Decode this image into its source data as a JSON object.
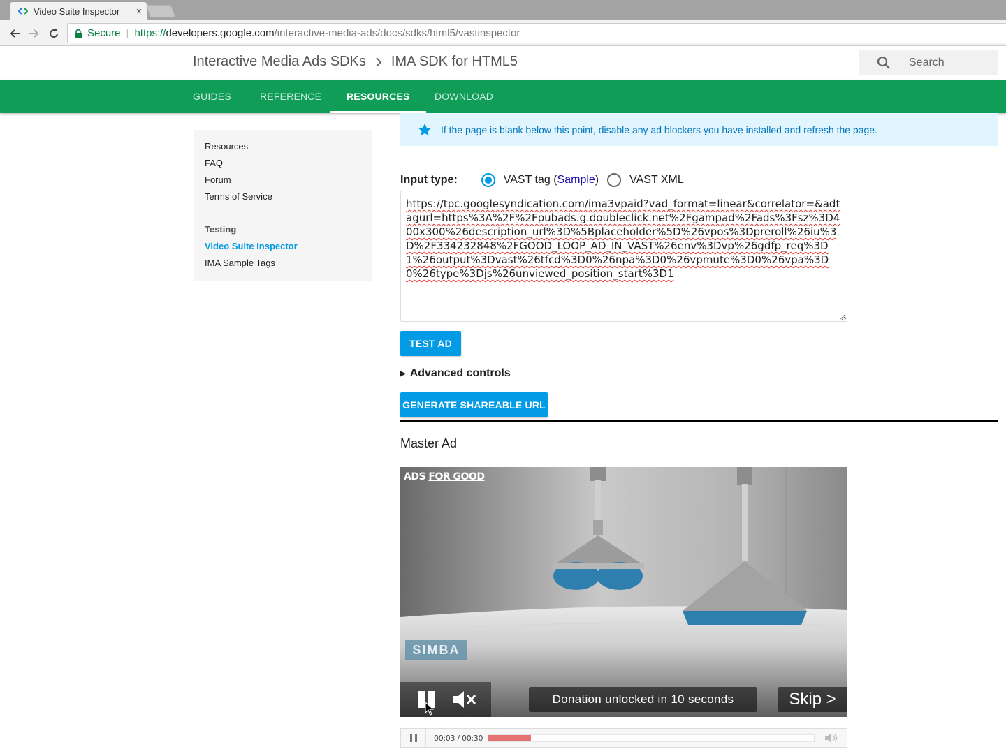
{
  "browser": {
    "tab_title": "Video Suite Inspector",
    "tab_close": "×",
    "secure_label": "Secure",
    "url_scheme": "https://",
    "url_host": "developers.google.com",
    "url_path": "/interactive-media-ads/docs/sdks/html5/vastinspector"
  },
  "header": {
    "breadcrumb_1": "Interactive Media Ads SDKs",
    "breadcrumb_2": "IMA SDK for HTML5",
    "search_placeholder": "Search"
  },
  "nav_tabs": [
    {
      "label": "GUIDES",
      "active": false
    },
    {
      "label": "REFERENCE",
      "active": false
    },
    {
      "label": "RESOURCES",
      "active": true
    },
    {
      "label": "DOWNLOAD",
      "active": false
    }
  ],
  "sidebar": {
    "items": [
      "Resources",
      "FAQ",
      "Forum",
      "Terms of Service"
    ],
    "section_heading": "Testing",
    "section_items": [
      {
        "label": "Video Suite Inspector",
        "active": true
      },
      {
        "label": "IMA Sample Tags",
        "active": false
      }
    ]
  },
  "notice": {
    "text": "If the page is blank below this point, disable any ad blockers you have installed and refresh the page.",
    "color": "#0277bd"
  },
  "form": {
    "input_type_label": "Input type:",
    "option_vast_tag_prefix": "VAST tag (",
    "option_vast_tag_link": "Sample",
    "option_vast_tag_suffix": ")",
    "option_vast_xml": "VAST XML",
    "selected_option": "VAST tag",
    "vast_tag_value": "https://tpc.googlesyndication.com/ima3vpaid?vad_format=linear&correlator=&adtagurl=https%3A%2F%2Fpubads.g.doubleclick.net%2Fgampad%2Fads%3Fsz%3D400x300%26description_url%3D%5Bplaceholder%5D%26vpos%3Dpreroll%26iu%3D%2F334232848%2FGOOD_LOOP_AD_IN_VAST%26env%3Dvp%26gdfp_req%3D1%26output%3Dvast%26tfcd%3D0%26npa%3D0%26vpmute%3D0%26vpa%3D0%26type%3Djs%26unviewed_position_start%3D1",
    "test_ad_button": "TEST AD",
    "advanced_controls": "Advanced controls",
    "generate_url_button": "GENERATE SHAREABLE URL",
    "accent_color": "#039be5"
  },
  "master_ad": {
    "heading": "Master Ad",
    "brand_left": "ADS ",
    "brand_right": "FOR GOOD",
    "product_logo": "SIMBA",
    "donation_text": "Donation unlocked in 10 seconds",
    "skip_label": "Skip >",
    "pause_icon": "pause-icon",
    "mute_icon": "speaker-muted-icon"
  },
  "player": {
    "time": "00:03 / 00:30",
    "progress_fraction": 0.13,
    "progress_color": "#e57373"
  }
}
